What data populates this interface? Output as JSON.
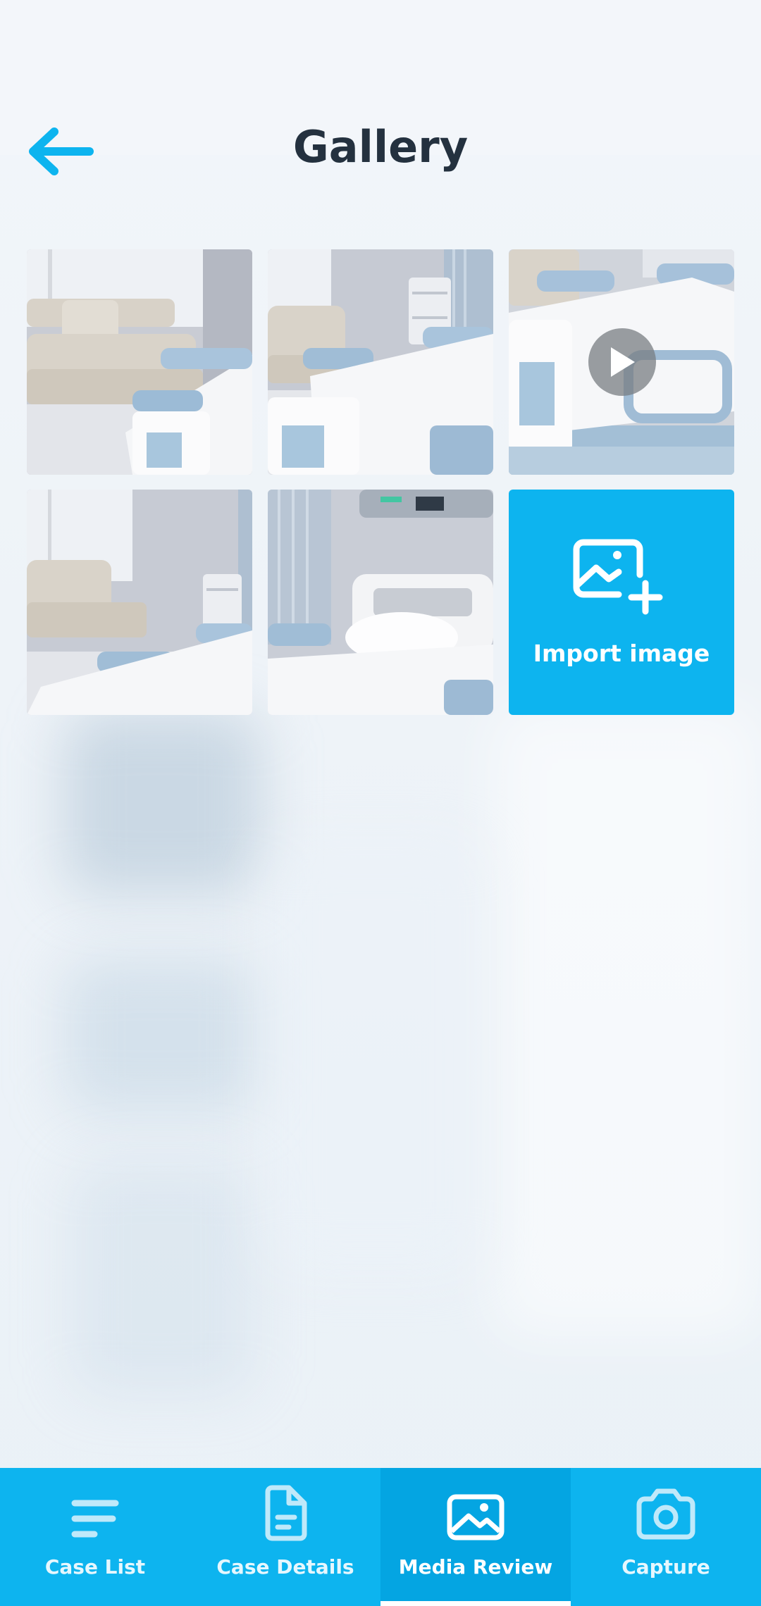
{
  "header": {
    "title": "Gallery",
    "back_icon": "arrow-left-icon"
  },
  "colors": {
    "accent": "#0db4ef",
    "accent_dark": "#04a5e2",
    "title": "#24313f",
    "background": "#f2f6fa"
  },
  "gallery": {
    "items": [
      {
        "type": "image",
        "scene": "sofa-and-bed"
      },
      {
        "type": "image",
        "scene": "bed-with-cabinet"
      },
      {
        "type": "video",
        "scene": "bed-closeup",
        "overlay_icon": "play-icon"
      },
      {
        "type": "image",
        "scene": "sofa-bed-cabinet"
      },
      {
        "type": "image",
        "scene": "bed-with-pillow"
      }
    ],
    "import": {
      "label": "Import image",
      "icon": "image-plus-icon"
    }
  },
  "tabs": [
    {
      "label": "Case List",
      "icon": "list-icon",
      "active": false
    },
    {
      "label": "Case Details",
      "icon": "document-icon",
      "active": false
    },
    {
      "label": "Media Review",
      "icon": "image-icon",
      "active": true
    },
    {
      "label": "Capture",
      "icon": "camera-icon",
      "active": false
    }
  ]
}
